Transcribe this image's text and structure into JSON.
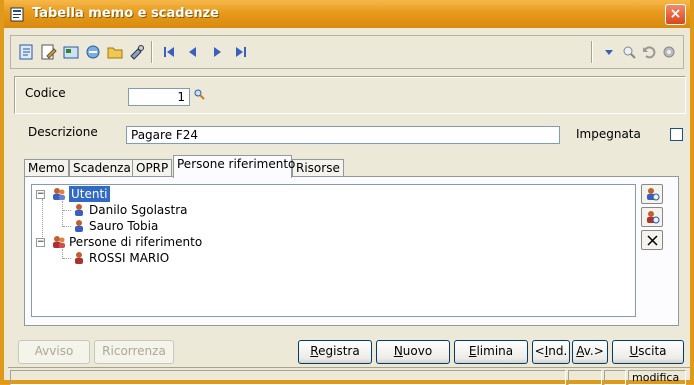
{
  "window": {
    "title": "Tabella memo e scadenze",
    "close_glyph": "×"
  },
  "toolbar": {
    "buttons": [
      "new-record-icon",
      "edit-icon",
      "properties-icon",
      "refresh-icon",
      "folder-icon",
      "tools-icon",
      "first-record-icon",
      "previous-record-icon",
      "next-record-icon",
      "last-record-icon"
    ],
    "right_buttons": [
      "dropdown-icon",
      "search-icon",
      "undo-icon",
      "settings-icon"
    ]
  },
  "form": {
    "codice_label": "Codice",
    "codice_value": "1",
    "descrizione_label": "Descrizione",
    "descrizione_value": "Pagare F24",
    "impegnata_label": "Impegnata"
  },
  "tabs": [
    "Memo",
    "Scadenza",
    "OPRP",
    "Persone riferimento",
    "Risorse"
  ],
  "active_tab": "Persone riferimento",
  "tree": {
    "groups": [
      {
        "label": "Utenti",
        "expanded": true,
        "selected": true,
        "children": [
          "Danilo Sgolastra",
          "Sauro Tobia"
        ]
      },
      {
        "label": "Persone di riferimento",
        "expanded": true,
        "selected": false,
        "children": [
          "ROSSI MARIO"
        ]
      }
    ],
    "expander_symbol": "−"
  },
  "side_buttons": [
    "add-user-icon",
    "find-user-icon",
    "delete-icon"
  ],
  "buttons": {
    "avviso": "Avviso",
    "ricorrenza": "Ricorrenza",
    "registra_first": "R",
    "registra_rest": "egistra",
    "nuovo_first": "N",
    "nuovo_rest": "uovo",
    "elimina_first": "E",
    "elimina_rest": "limina",
    "ind_pre": "<",
    "ind_ul": "I",
    "ind_rest": "nd.",
    "av_ul": "A",
    "av_rest": "v.>",
    "uscita_first": "U",
    "uscita_rest": "scita"
  },
  "status": {
    "mode": "modifica"
  },
  "colors": {
    "accent": "#e79a1c",
    "selection": "#316ac5"
  }
}
